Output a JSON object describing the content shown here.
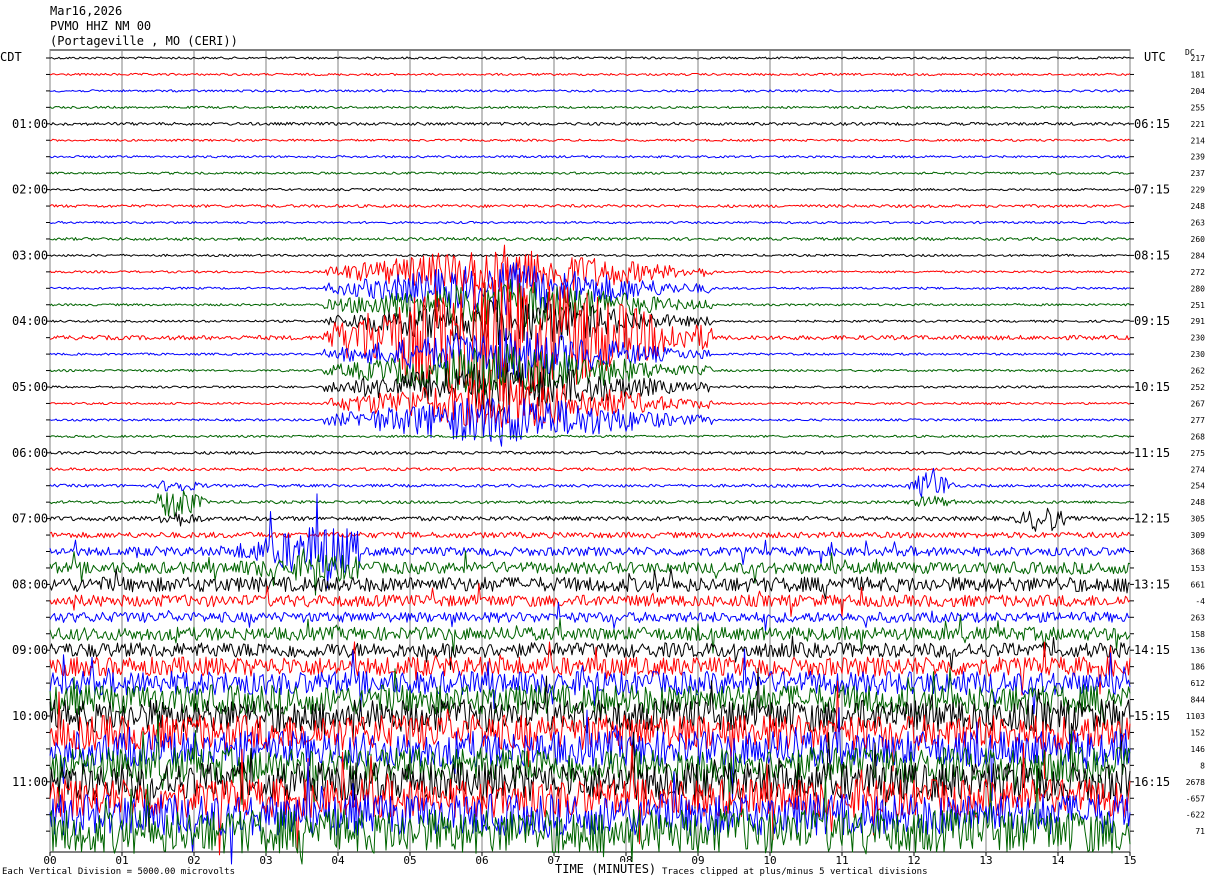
{
  "header": {
    "date": "Mar16,2026",
    "station": "PVMO HHZ NM 00",
    "location": "(Portageville , MO (CERI))"
  },
  "timezones": {
    "left": "CDT",
    "right": "UTC",
    "dc": "DC"
  },
  "footer": {
    "scale_note": "Each Vertical Division = 5000.00 microvolts",
    "clip_note": "Traces clipped at plus/minus 5 vertical divisions"
  },
  "colors": {
    "trace_cycle": [
      "#000000",
      "#ff0000",
      "#0000ff",
      "#006400"
    ],
    "grid": "#808080"
  },
  "chart_data": {
    "type": "line",
    "title": "PVMO HHZ NM 00",
    "xlabel": "TIME (MINUTES)",
    "ylabel": "",
    "x_ticks": [
      "00",
      "01",
      "02",
      "03",
      "04",
      "05",
      "06",
      "07",
      "08",
      "09",
      "10",
      "11",
      "12",
      "13",
      "14",
      "15"
    ],
    "xlim": [
      0,
      15
    ],
    "rows_per_hour": 4,
    "left_hour_labels": [
      "01:00",
      "02:00",
      "03:00",
      "04:00",
      "05:00",
      "06:00",
      "07:00",
      "08:00",
      "09:00",
      "10:00",
      "11:00"
    ],
    "right_hour_labels": [
      "06:15",
      "07:15",
      "08:15",
      "09:15",
      "10:15",
      "11:15",
      "12:15",
      "13:15",
      "14:15",
      "15:15",
      "16:15"
    ],
    "dc_offsets": [
      "217",
      "181",
      "204",
      "255",
      "221",
      "214",
      "239",
      "237",
      "229",
      "248",
      "263",
      "260",
      "284",
      "272",
      "280",
      "251",
      "291",
      "230",
      "230",
      "262",
      "252",
      "267",
      "277",
      "268",
      "275",
      "274",
      "254",
      "248",
      "305",
      "309",
      "368",
      "153",
      "661",
      "-4",
      "263",
      "158",
      "136",
      "186",
      "612",
      "844",
      "1103",
      "152",
      "146",
      "8",
      "2678",
      "-657",
      "-622",
      "71"
    ],
    "events": [
      {
        "rows": [
          13,
          14,
          15,
          16,
          17,
          18,
          19,
          20,
          21,
          22
        ],
        "x_start": 3.8,
        "x_end": 9.2,
        "peak_x": 6.3,
        "amplitude": 10,
        "color_row": 17
      },
      {
        "rows": [
          26,
          27
        ],
        "x_start": 11.9,
        "x_end": 12.6,
        "peak_x": 12.25,
        "amplitude": 2.5,
        "color_row": 26
      },
      {
        "rows": [
          26,
          27,
          28
        ],
        "x_start": 1.5,
        "x_end": 2.2,
        "peak_x": 1.75,
        "amplitude": 2.5,
        "color_row": 27
      },
      {
        "rows": [
          30,
          31
        ],
        "x_start": 2.5,
        "x_end": 4.3,
        "peak_x": 3.8,
        "amplitude": 3.5,
        "color_row": 30
      },
      {
        "rows": [
          28
        ],
        "x_start": 13.4,
        "x_end": 14.1,
        "peak_x": 13.8,
        "amplitude": 2,
        "color_row": 28
      }
    ],
    "noise_levels": [
      0.15,
      0.15,
      0.15,
      0.15,
      0.2,
      0.15,
      0.15,
      0.15,
      0.15,
      0.2,
      0.15,
      0.2,
      0.15,
      0.15,
      0.15,
      0.15,
      0.15,
      0.3,
      0.15,
      0.15,
      0.15,
      0.15,
      0.15,
      0.15,
      0.2,
      0.2,
      0.2,
      0.2,
      0.3,
      0.4,
      0.6,
      0.8,
      1.0,
      0.8,
      0.7,
      0.9,
      1.0,
      1.3,
      1.6,
      2.0,
      2.2,
      2.4,
      2.4,
      2.4,
      2.6,
      2.6,
      2.8,
      3.0
    ]
  }
}
